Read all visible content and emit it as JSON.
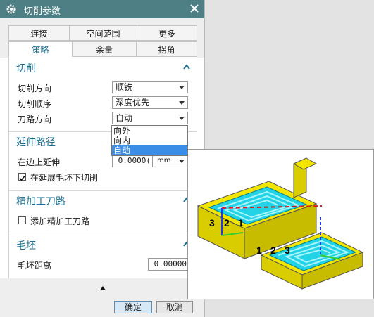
{
  "dialog": {
    "title": "切削参数",
    "tabs_row1": [
      "连接",
      "空间范围",
      "更多"
    ],
    "tabs_row2": [
      "策略",
      "余量",
      "拐角"
    ],
    "active_tab": "策略"
  },
  "cut": {
    "header": "切削",
    "direction_label": "切削方向",
    "direction_value": "顺铣",
    "order_label": "切削顺序",
    "order_value": "深度优先",
    "toolpath_label": "刀路方向",
    "toolpath_value": "自动",
    "toolpath_options": [
      "向外",
      "向内",
      "自动"
    ]
  },
  "extend": {
    "header": "延伸路径",
    "edge_label": "在边上延伸",
    "edge_value": "0.0000(",
    "edge_unit": "mm",
    "cut_under_label": "在延展毛坯下切削",
    "cut_under_checked": true
  },
  "finish": {
    "header": "精加工刀路",
    "add_label": "添加精加工刀路",
    "add_checked": false
  },
  "blank": {
    "header": "毛坯",
    "distance_label": "毛坯距离",
    "distance_value": "0.00000"
  },
  "buttons": {
    "ok": "确定",
    "cancel": "取消"
  },
  "preview": {
    "left_numbers": [
      "3",
      "2",
      "1"
    ],
    "right_numbers": [
      "1",
      "2",
      "3"
    ]
  },
  "colors": {
    "titlebar": "#4d7f84",
    "accent": "#1b6e8f",
    "selection": "#3a8ee6",
    "part_yellow": "#f2e600",
    "pocket_cyan": "#22d3e6"
  }
}
